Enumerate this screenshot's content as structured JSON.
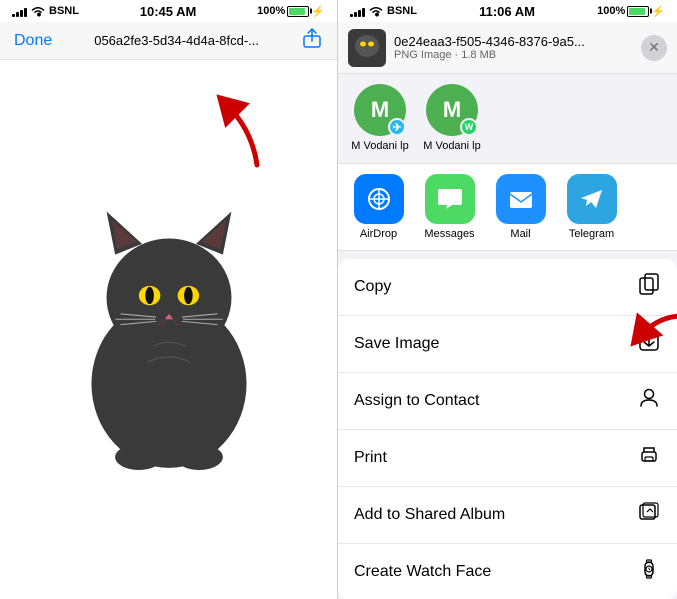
{
  "left": {
    "status": {
      "carrier": "BSNL",
      "time": "10:45 AM",
      "battery": "100%"
    },
    "nav": {
      "done_label": "Done",
      "title": "056a2fe3-5d34-4d4a-8fcd-..."
    }
  },
  "right": {
    "status": {
      "carrier": "BSNL",
      "time": "11:06 AM",
      "battery": "100%"
    },
    "file": {
      "name": "0e24eaa3-f505-4346-8376-9a5...",
      "meta": "PNG Image · 1.8 MB"
    },
    "contacts": [
      {
        "initial": "M",
        "color": "#4CAF50",
        "badge_color": "#29B6F6",
        "badge": "✈",
        "name": "M Vodani lp"
      },
      {
        "initial": "M",
        "color": "#4CAF50",
        "badge_color": "#25D366",
        "badge": "W",
        "name": "M Vodani lp"
      }
    ],
    "apps": [
      {
        "label": "AirDrop",
        "color": "#007aff",
        "icon": "◎"
      },
      {
        "label": "Messages",
        "color": "#4cd964",
        "icon": "💬"
      },
      {
        "label": "Mail",
        "color": "#1E90FF",
        "icon": "✉"
      },
      {
        "label": "Telegram",
        "color": "#2CA5E0",
        "icon": "✈"
      }
    ],
    "actions": [
      {
        "label": "Copy",
        "icon": "⎘"
      },
      {
        "label": "Save Image",
        "icon": "⬇"
      },
      {
        "label": "Assign to Contact",
        "icon": "👤"
      },
      {
        "label": "Print",
        "icon": "🖨"
      },
      {
        "label": "Add to Shared Album",
        "icon": "🖼"
      },
      {
        "label": "Create Watch Face",
        "icon": "⌚"
      }
    ]
  }
}
